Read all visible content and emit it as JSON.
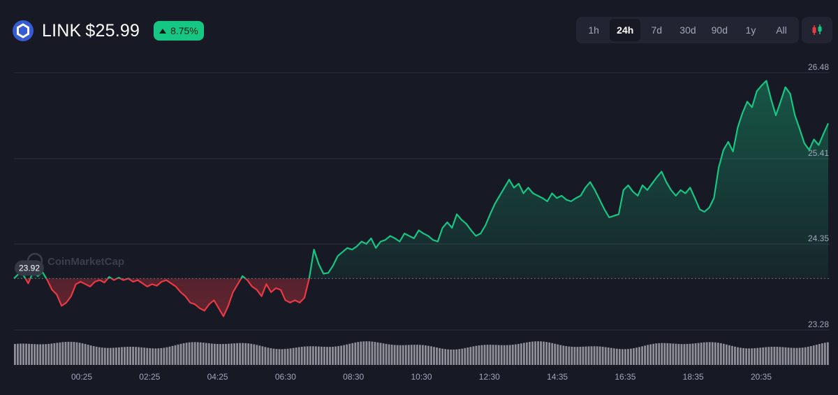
{
  "header": {
    "symbol": "LINK",
    "price": "$25.99",
    "change": "8.75%",
    "change_direction": "up"
  },
  "range_tabs": {
    "options": [
      "1h",
      "24h",
      "7d",
      "30d",
      "90d",
      "1y",
      "All"
    ],
    "active": "24h"
  },
  "watermark": "CoinMarketCap",
  "colors": {
    "background": "#171924",
    "up": "#16c784",
    "down": "#ea3943",
    "grid": "#2f3341",
    "volume": "#8e8f99",
    "icon": "#375bd2"
  },
  "chart_data": {
    "type": "line",
    "baseline_value": 23.92,
    "baseline_label": "23.92",
    "y_ticks": [
      26.48,
      25.41,
      24.35,
      23.28
    ],
    "y_tick_labels": [
      "26.48",
      "25.41",
      "24.35",
      "23.28"
    ],
    "ylim": [
      23.28,
      26.48
    ],
    "x_ticks": [
      "00:25",
      "02:25",
      "04:25",
      "06:30",
      "08:30",
      "10:30",
      "12:30",
      "14:35",
      "16:35",
      "18:35",
      "20:35"
    ],
    "grid": "horizontal",
    "series": [
      {
        "values": [
          23.92,
          23.98,
          23.96,
          23.86,
          24.0,
          23.95,
          24.0,
          23.9,
          23.78,
          23.72,
          23.58,
          23.62,
          23.7,
          23.85,
          23.88,
          23.85,
          23.82,
          23.88,
          23.9,
          23.87,
          23.94,
          23.9,
          23.93,
          23.9,
          23.92,
          23.88,
          23.9,
          23.86,
          23.82,
          23.85,
          23.83,
          23.88,
          23.9,
          23.86,
          23.82,
          23.75,
          23.7,
          23.62,
          23.6,
          23.55,
          23.52,
          23.6,
          23.65,
          23.55,
          23.45,
          23.58,
          23.75,
          23.85,
          23.95,
          23.9,
          23.82,
          23.78,
          23.7,
          23.85,
          23.75,
          23.8,
          23.78,
          23.65,
          23.62,
          23.65,
          23.62,
          23.68,
          23.92,
          24.28,
          24.1,
          23.98,
          23.99,
          24.08,
          24.2,
          24.25,
          24.3,
          24.28,
          24.32,
          24.38,
          24.35,
          24.42,
          24.3,
          24.38,
          24.4,
          24.45,
          24.42,
          24.38,
          24.48,
          24.45,
          24.42,
          24.52,
          24.48,
          24.45,
          24.4,
          24.38,
          24.55,
          24.62,
          24.55,
          24.72,
          24.65,
          24.6,
          24.52,
          24.45,
          24.48,
          24.58,
          24.72,
          24.85,
          24.95,
          25.05,
          25.15,
          25.05,
          25.1,
          24.98,
          25.05,
          24.98,
          24.95,
          24.92,
          24.88,
          24.98,
          24.92,
          24.95,
          24.9,
          24.88,
          24.92,
          24.95,
          25.05,
          25.12,
          25.02,
          24.9,
          24.78,
          24.68,
          24.7,
          24.72,
          25.02,
          25.08,
          25.0,
          24.95,
          25.08,
          25.02,
          25.1,
          25.18,
          25.25,
          25.12,
          25.02,
          24.95,
          25.02,
          24.98,
          25.05,
          24.92,
          24.78,
          24.75,
          24.8,
          24.92,
          25.3,
          25.52,
          25.62,
          25.5,
          25.8,
          25.98,
          26.12,
          26.05,
          26.25,
          26.32,
          26.38,
          26.15,
          25.95,
          26.12,
          26.3,
          26.22,
          25.95,
          25.78,
          25.6,
          25.52,
          25.65,
          25.58,
          25.72,
          25.85
        ]
      }
    ]
  }
}
